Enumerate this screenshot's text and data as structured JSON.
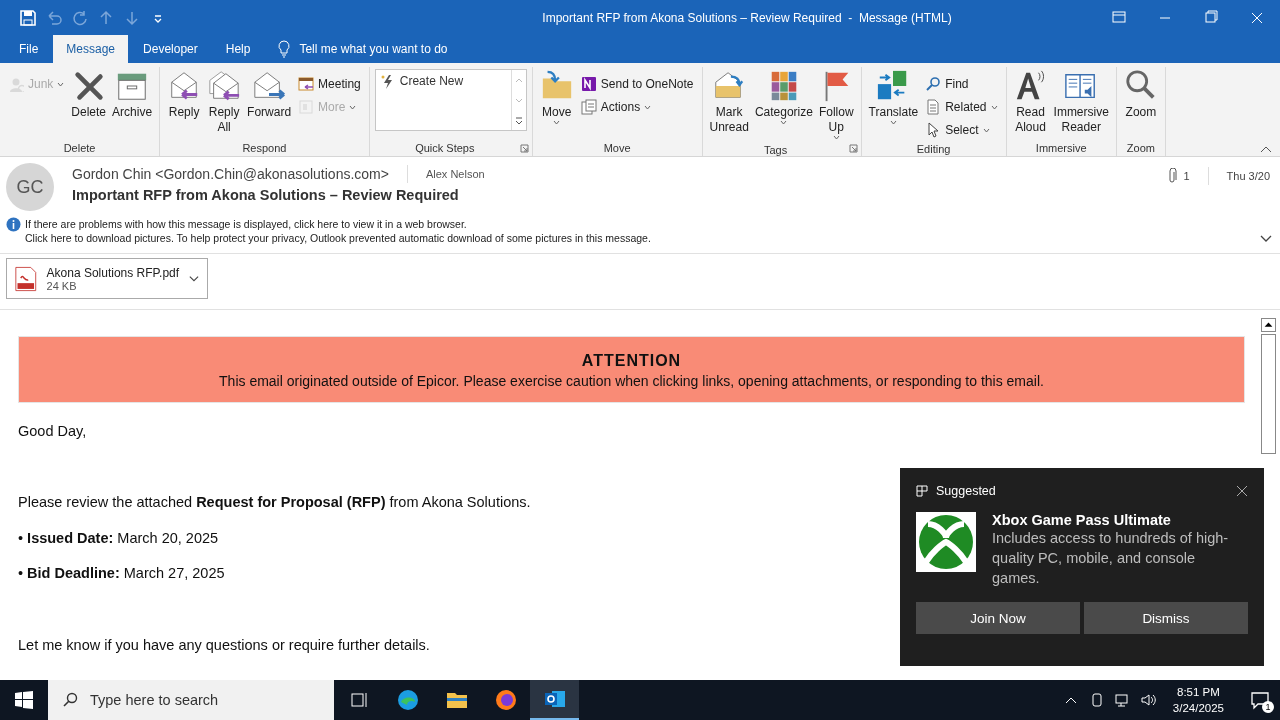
{
  "window": {
    "title": "Important RFP from Akona Solutions – Review Required  -  Message (HTML)"
  },
  "tabs": [
    {
      "label": "File",
      "selected": false
    },
    {
      "label": "Message",
      "selected": true
    },
    {
      "label": "Developer",
      "selected": false
    },
    {
      "label": "Help",
      "selected": false
    }
  ],
  "tell_me": {
    "placeholder": "Tell me what you want to do"
  },
  "ribbon": [
    {
      "label": "Delete",
      "launcher": false,
      "items": [
        {
          "kind": "small",
          "label": "Junk",
          "dropdown": true,
          "disabled": true
        },
        {
          "kind": "large",
          "label": "Delete",
          "dropdown": false,
          "disabled": false
        },
        {
          "kind": "large",
          "label": "Archive",
          "dropdown": false,
          "disabled": false
        }
      ]
    },
    {
      "label": "Respond",
      "launcher": false,
      "items": [
        {
          "kind": "large",
          "label": "Reply",
          "dropdown": false,
          "disabled": false
        },
        {
          "kind": "large",
          "label": "Reply All",
          "dropdown": false,
          "disabled": false
        },
        {
          "kind": "large",
          "label": "Forward",
          "dropdown": false,
          "disabled": false
        },
        {
          "kind": "small",
          "label": "Meeting",
          "dropdown": false,
          "disabled": false
        },
        {
          "kind": "small",
          "label": "More",
          "dropdown": true,
          "disabled": true
        }
      ]
    },
    {
      "label": "Quick Steps",
      "launcher": true,
      "items": [
        {
          "kind": "gallery",
          "label": "Create New"
        }
      ]
    },
    {
      "label": "Move",
      "launcher": false,
      "items": [
        {
          "kind": "large",
          "label": "Move",
          "dropdown": true,
          "disabled": false
        },
        {
          "kind": "small",
          "label": "Send to OneNote",
          "dropdown": false,
          "disabled": false
        },
        {
          "kind": "small",
          "label": "Actions",
          "dropdown": true,
          "disabled": false
        }
      ]
    },
    {
      "label": "Tags",
      "launcher": true,
      "items": [
        {
          "kind": "large",
          "label": "Mark Unread",
          "dropdown": false,
          "disabled": false
        },
        {
          "kind": "large",
          "label": "Categorize",
          "dropdown": true,
          "disabled": false
        },
        {
          "kind": "large",
          "label": "Follow Up",
          "dropdown": true,
          "disabled": false
        }
      ]
    },
    {
      "label": "Editing",
      "launcher": false,
      "items": [
        {
          "kind": "large",
          "label": "Translate",
          "dropdown": true,
          "disabled": false
        },
        {
          "kind": "small",
          "label": "Find",
          "dropdown": false,
          "disabled": false
        },
        {
          "kind": "small",
          "label": "Related",
          "dropdown": true,
          "disabled": false
        },
        {
          "kind": "small",
          "label": "Select",
          "dropdown": true,
          "disabled": false
        }
      ]
    },
    {
      "label": "Immersive",
      "launcher": false,
      "items": [
        {
          "kind": "large",
          "label": "Read Aloud",
          "dropdown": false,
          "disabled": false
        },
        {
          "kind": "large",
          "label": "Immersive Reader",
          "dropdown": false,
          "disabled": false
        }
      ]
    },
    {
      "label": "Zoom",
      "launcher": false,
      "items": [
        {
          "kind": "large",
          "label": "Zoom",
          "dropdown": false,
          "disabled": false
        }
      ]
    }
  ],
  "message": {
    "avatar": "GC",
    "sender": "Gordon Chin <Gordon.Chin@akonasolutions.com>",
    "recipient": "Alex Nelson",
    "subject": "Important RFP from Akona Solutions – Review Required",
    "attachment_count": "1",
    "date": "Thu 3/20",
    "info": [
      "If there are problems with how this message is displayed, click here to view it in a web browser.",
      "Click here to download pictures. To help protect your privacy, Outlook prevented automatic download of some pictures in this message."
    ],
    "attachment": {
      "name": "Akona Solutions RFP.pdf",
      "size": "24 KB"
    }
  },
  "body": {
    "banner": {
      "title": "ATTENTION",
      "text": "This email originated outside of Epicor. Please exercise caution when clicking links, opening attachments, or responding to this email."
    },
    "paragraphs": [
      "Good Day,",
      "Please review the attached **Request for Proposal (RFP)** from Akona Solutions.",
      "• **Issued Date:** March 20, 2025",
      "• **Bid Deadline:** March 27, 2025",
      "Let me know if you have any questions or require further details."
    ]
  },
  "toast": {
    "header": "Suggested",
    "title": "Xbox Game Pass Ultimate",
    "text": "Includes access to hundreds of high-quality PC, mobile, and console games.",
    "buttons": [
      "Join Now",
      "Dismiss"
    ]
  },
  "taskbar": {
    "search_placeholder": "Type here to search",
    "time": "8:51 PM",
    "date": "3/24/2025",
    "notifications": "1"
  }
}
